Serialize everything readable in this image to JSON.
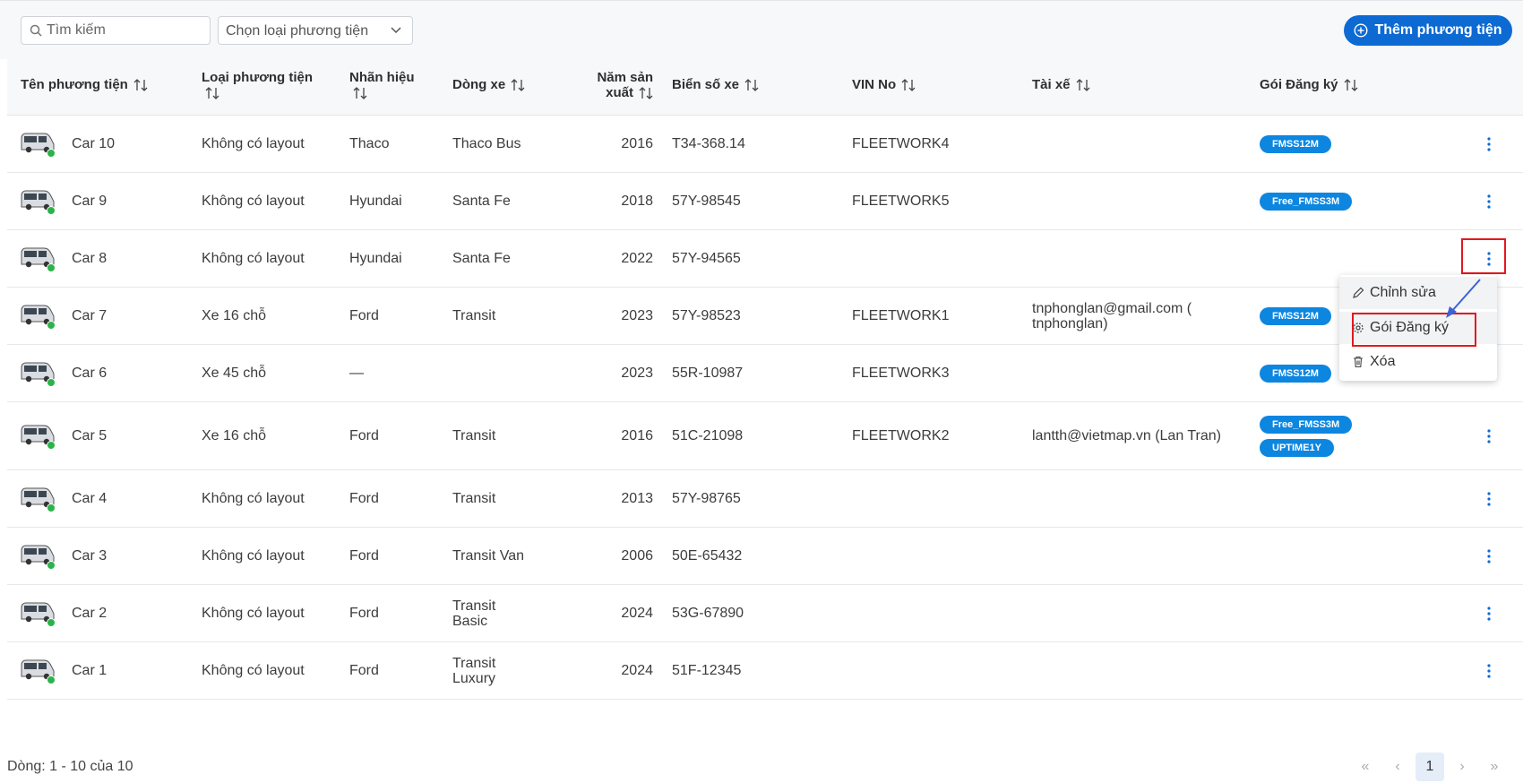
{
  "toolbar": {
    "search_placeholder": "Tìm kiếm",
    "vehicle_type_select": "Chọn loại phương tiện",
    "add_button": "Thêm phương tiện"
  },
  "columns": {
    "name": "Tên phương tiện",
    "type": "Loại phương tiện",
    "brand": "Nhãn hiệu",
    "model": "Dòng xe",
    "year_line1": "Năm sản",
    "year_line2": "xuất",
    "plate": "Biển số xe",
    "vin": "VIN No",
    "driver": "Tài xế",
    "package": "Gói Đăng ký"
  },
  "rows": [
    {
      "name": "Car 10",
      "type": "Không có layout",
      "brand": "Thaco",
      "model": "Thaco Bus",
      "model2": "",
      "year": "2016",
      "plate": "T34-368.14",
      "vin": "FLEETWORK4",
      "driver": "",
      "driver2": "",
      "badges": [
        "FMSS12M"
      ]
    },
    {
      "name": "Car 9",
      "type": "Không có layout",
      "brand": "Hyundai",
      "model": "Santa Fe",
      "model2": "",
      "year": "2018",
      "plate": "57Y-98545",
      "vin": "FLEETWORK5",
      "driver": "",
      "driver2": "",
      "badges": [
        "Free_FMSS3M"
      ]
    },
    {
      "name": "Car 8",
      "type": "Không có layout",
      "brand": "Hyundai",
      "model": "Santa Fe",
      "model2": "",
      "year": "2022",
      "plate": "57Y-94565",
      "vin": "",
      "driver": "",
      "driver2": "",
      "badges": []
    },
    {
      "name": "Car 7",
      "type": "Xe 16 chỗ",
      "brand": "Ford",
      "model": "Transit",
      "model2": "",
      "year": "2023",
      "plate": "57Y-98523",
      "vin": "FLEETWORK1",
      "driver": "tnphonglan@gmail.com (",
      "driver2": "tnphonglan)",
      "badges": [
        "FMSS12M"
      ]
    },
    {
      "name": "Car 6",
      "type": "Xe 45 chỗ",
      "brand": "—",
      "model": "",
      "model2": "",
      "year": "2023",
      "plate": "55R-10987",
      "vin": "FLEETWORK3",
      "driver": "",
      "driver2": "",
      "badges": [
        "FMSS12M"
      ]
    },
    {
      "name": "Car 5",
      "type": "Xe 16 chỗ",
      "brand": "Ford",
      "model": "Transit",
      "model2": "",
      "year": "2016",
      "plate": "51C-21098",
      "vin": "FLEETWORK2",
      "driver": "lantth@vietmap.vn (Lan Tran)",
      "driver2": "",
      "badges": [
        "Free_FMSS3M",
        "UPTIME1Y"
      ]
    },
    {
      "name": "Car 4",
      "type": "Không có layout",
      "brand": "Ford",
      "model": "Transit",
      "model2": "",
      "year": "2013",
      "plate": "57Y-98765",
      "vin": "",
      "driver": "",
      "driver2": "",
      "badges": []
    },
    {
      "name": "Car 3",
      "type": "Không có layout",
      "brand": "Ford",
      "model": "Transit Van",
      "model2": "",
      "year": "2006",
      "plate": "50E-65432",
      "vin": "",
      "driver": "",
      "driver2": "",
      "badges": []
    },
    {
      "name": "Car 2",
      "type": "Không có layout",
      "brand": "Ford",
      "model": "Transit",
      "model2": "Basic",
      "year": "2024",
      "plate": "53G-67890",
      "vin": "",
      "driver": "",
      "driver2": "",
      "badges": []
    },
    {
      "name": "Car 1",
      "type": "Không có layout",
      "brand": "Ford",
      "model": "Transit",
      "model2": "Luxury",
      "year": "2024",
      "plate": "51F-12345",
      "vin": "",
      "driver": "",
      "driver2": "",
      "badges": []
    }
  ],
  "context_menu": {
    "edit": "Chỉnh sửa",
    "package": "Gói Đăng ký",
    "delete": "Xóa"
  },
  "footer": {
    "rows_info": "Dòng: 1 - 10 của 10",
    "current_page": "1"
  },
  "colors": {
    "primary": "#0d6ad3",
    "badge": "#0d86e0",
    "highlight": "#e3181f",
    "online": "#2bb34a"
  }
}
